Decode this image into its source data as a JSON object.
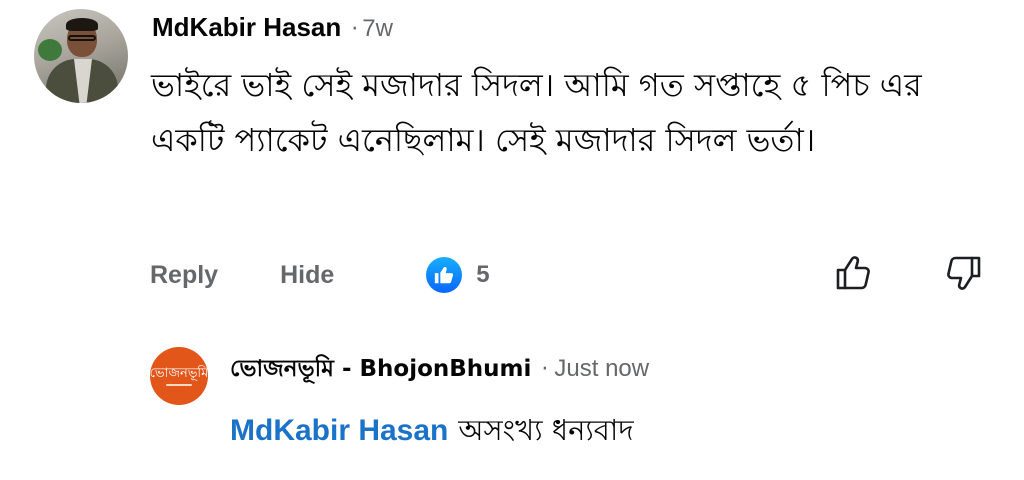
{
  "comment": {
    "author": "MdKabir Hasan",
    "time": "7w",
    "text": "ভাইরে ভাই  সেই  মজাদার সিদল। আমি গত সপ্তাহে ৫ পিচ এর একটি প্যাকেট এনেছিলাম। সেই  মজাদার সিদল ভর্তা।",
    "actions": {
      "reply": "Reply",
      "hide": "Hide"
    },
    "reaction_count": "5",
    "reaction_icon": "like-badge-icon"
  },
  "reply": {
    "author": "ভোজনভূমি - BhojonBhumi",
    "time": "Just now",
    "mention": "MdKabir Hasan",
    "text": "অসংখ্য ধন্যবাদ",
    "logo_text": "ভোজনভূমি"
  },
  "icons": {
    "upvote": "thumbs-up-outline-icon",
    "downvote": "thumbs-down-outline-icon"
  },
  "colors": {
    "text": "#050505",
    "secondary": "#65676b",
    "mention": "#1a73c8",
    "like_blue": "#0866ff",
    "page_logo": "#e2561a"
  }
}
